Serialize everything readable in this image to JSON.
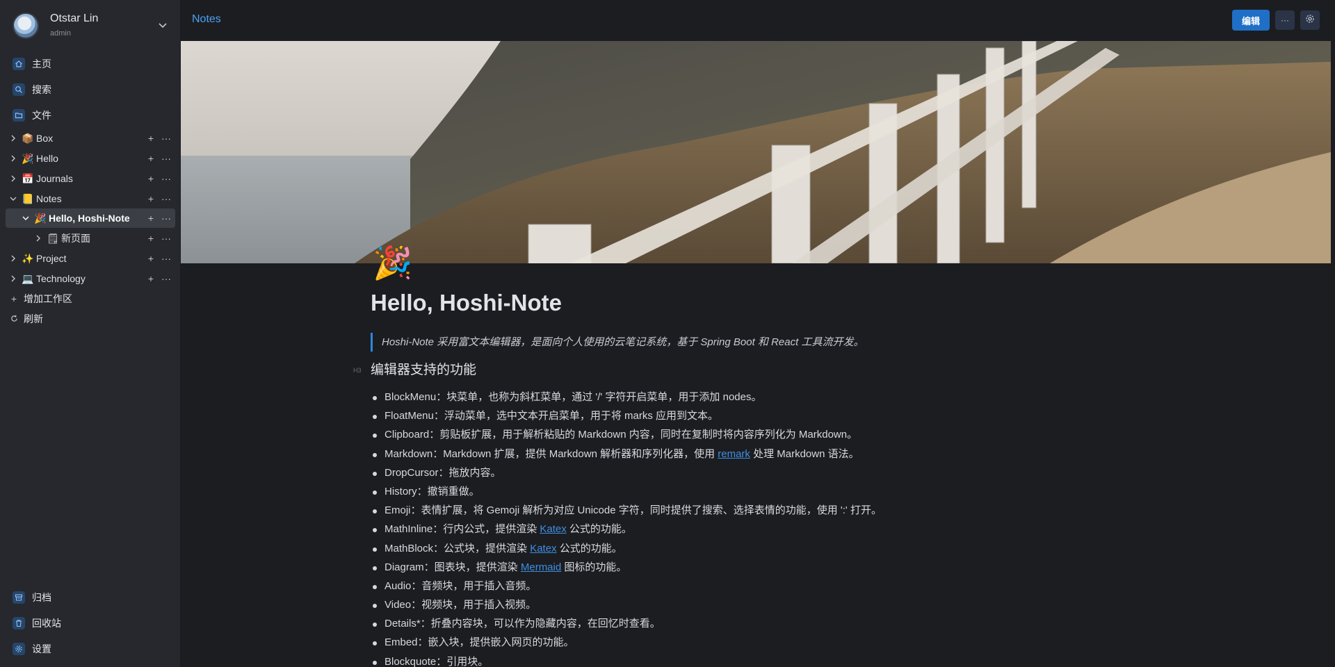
{
  "user": {
    "name": "Otstar Lin",
    "role": "admin"
  },
  "nav": [
    {
      "label": "主页",
      "icon": "home-icon"
    },
    {
      "label": "搜索",
      "icon": "search-icon"
    },
    {
      "label": "文件",
      "icon": "folder-icon"
    }
  ],
  "tree": [
    {
      "label": "Box",
      "emoji": "📦",
      "expanded": false
    },
    {
      "label": "Hello",
      "emoji": "🎉",
      "expanded": false
    },
    {
      "label": "Journals",
      "emoji": "📅",
      "expanded": false
    },
    {
      "label": "Notes",
      "emoji": "📒",
      "expanded": true
    },
    {
      "label": "Hello, Hoshi-Note",
      "emoji": "🎉",
      "expanded": true,
      "active": true
    },
    {
      "label": "新页面",
      "emoji": "🗒",
      "expanded": false
    },
    {
      "label": "Project",
      "emoji": "✨",
      "expanded": false
    },
    {
      "label": "Technology",
      "emoji": "💻",
      "expanded": false
    }
  ],
  "sidebar_actions": {
    "add_workspace": "增加工作区",
    "refresh": "刷新"
  },
  "bottom_nav": [
    {
      "label": "归档",
      "icon": "archive-icon"
    },
    {
      "label": "回收站",
      "icon": "trash-icon"
    },
    {
      "label": "设置",
      "icon": "settings-icon"
    }
  ],
  "topbar": {
    "breadcrumb": "Notes",
    "edit_label": "编辑",
    "more_label": "···"
  },
  "page": {
    "emoji": "🎉",
    "title": "Hello, Hoshi-Note",
    "quote": "Hoshi-Note 采用富文本编辑器，是面向个人使用的云笔记系统，基于 Spring Boot 和 React 工具流开发。",
    "h3_tag": "H3",
    "heading": "编辑器支持的功能",
    "features": [
      {
        "pre": "BlockMenu：块菜单，也称为斜杠菜单，通过 '/' 字符开启菜单，用于添加 nodes。",
        "link": "",
        "post": ""
      },
      {
        "pre": "FloatMenu：浮动菜单，选中文本开启菜单，用于将 marks 应用到文本。",
        "link": "",
        "post": ""
      },
      {
        "pre": "Clipboard：剪贴板扩展，用于解析粘贴的 Markdown 内容，同时在复制时将内容序列化为 Markdown。",
        "link": "",
        "post": ""
      },
      {
        "pre": "Markdown：Markdown 扩展，提供 Markdown 解析器和序列化器，使用 ",
        "link": "remark",
        "post": " 处理 Markdown 语法。"
      },
      {
        "pre": "DropCursor：拖放内容。",
        "link": "",
        "post": ""
      },
      {
        "pre": "History：撤销重做。",
        "link": "",
        "post": ""
      },
      {
        "pre": "Emoji：表情扩展，将 Gemoji 解析为对应 Unicode 字符，同时提供了搜索、选择表情的功能，使用 ':' 打开。",
        "link": "",
        "post": ""
      },
      {
        "pre": "MathInline：行内公式，提供渲染 ",
        "link": "Katex",
        "post": " 公式的功能。"
      },
      {
        "pre": "MathBlock：公式块，提供渲染 ",
        "link": "Katex",
        "post": " 公式的功能。"
      },
      {
        "pre": "Diagram：图表块，提供渲染 ",
        "link": "Mermaid",
        "post": " 图标的功能。"
      },
      {
        "pre": "Audio：音频块，用于插入音频。",
        "link": "",
        "post": ""
      },
      {
        "pre": "Video：视频块，用于插入视频。",
        "link": "",
        "post": ""
      },
      {
        "pre": "Details*：折叠内容块，可以作为隐藏内容，在回忆时查看。",
        "link": "",
        "post": ""
      },
      {
        "pre": "Embed：嵌入块，提供嵌入网页的功能。",
        "link": "",
        "post": ""
      },
      {
        "pre": "Blockquote：引用块。",
        "link": "",
        "post": ""
      }
    ]
  },
  "colors": {
    "accent": "#1f6fc7",
    "link": "#3e8fe4",
    "sidebar_bg": "#26282d",
    "main_bg": "#1c1d21"
  }
}
